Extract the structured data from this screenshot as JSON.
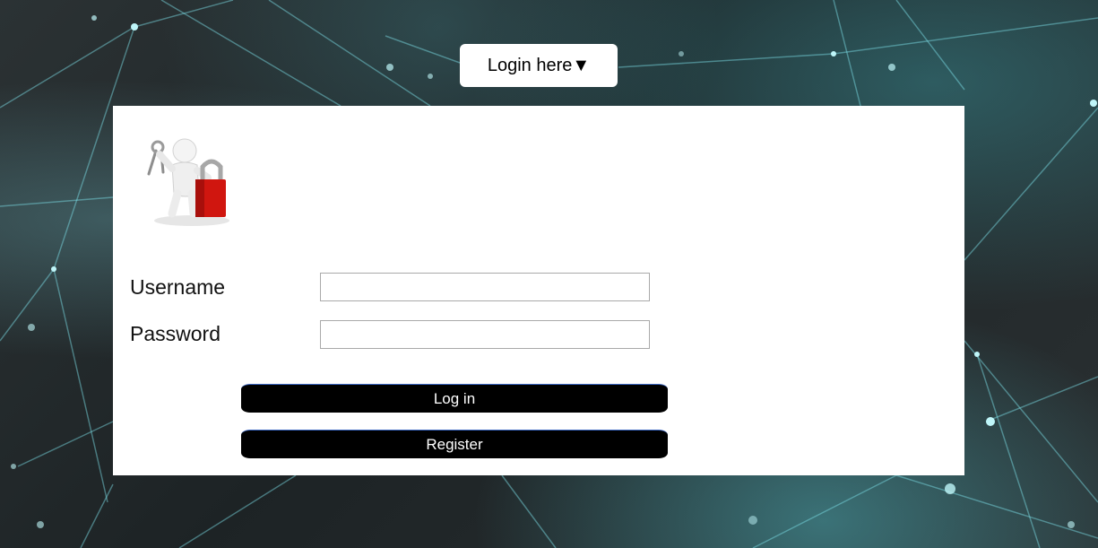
{
  "header": {
    "toggle_label": "Login here▼"
  },
  "form": {
    "username_label": "Username",
    "password_label": "Password",
    "username_value": "",
    "password_value": "",
    "login_label": "Log in",
    "register_label": "Register"
  },
  "logo": {
    "icon": "user-with-keys-and-padlock-icon"
  },
  "colors": {
    "panel_background": "#ffffff",
    "button_background": "#000000",
    "button_text": "#ffffff",
    "padlock": "#d0160f",
    "page_background": "#1f2628",
    "accent_network": "#4fd6e0"
  }
}
